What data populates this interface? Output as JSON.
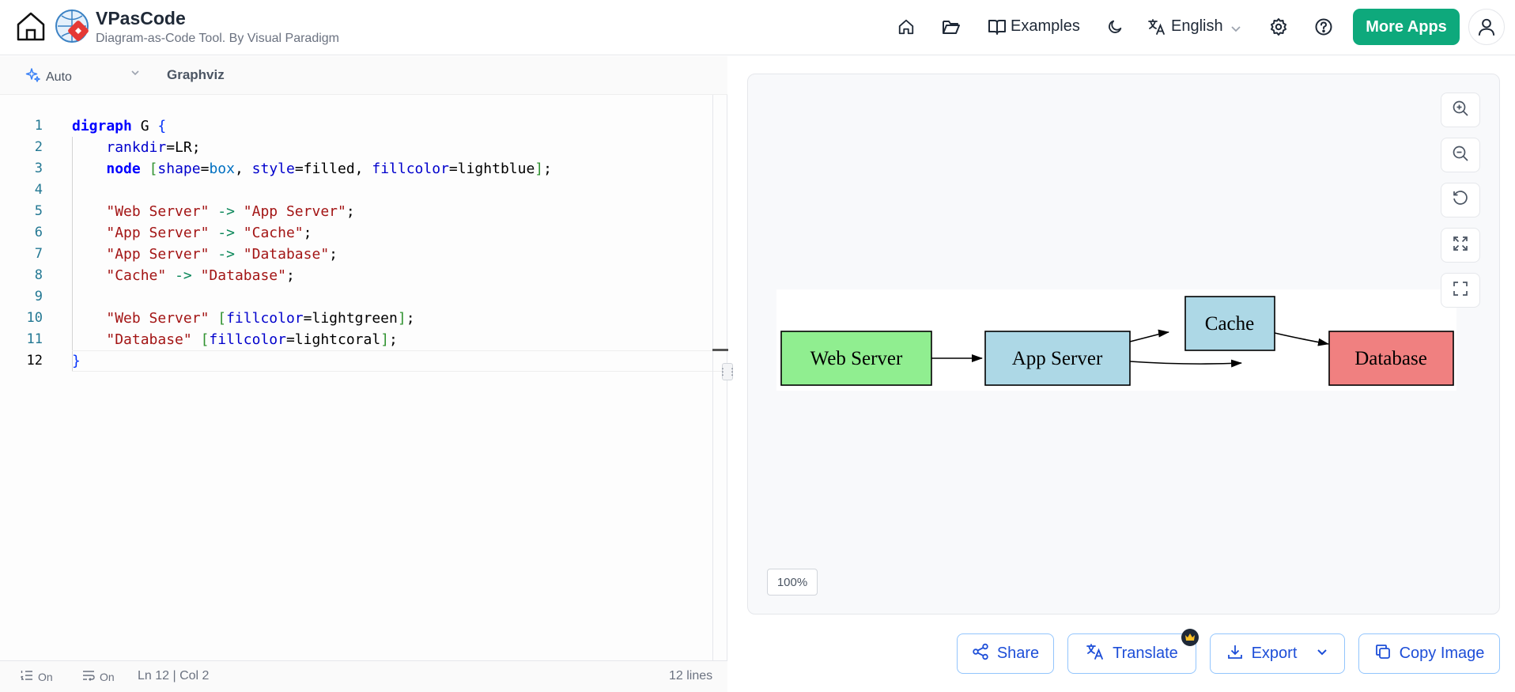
{
  "header": {
    "title": "VPasCode",
    "subtitle": "Diagram-as-Code Tool. By Visual Paradigm",
    "examples_label": "Examples",
    "language_label": "English",
    "more_apps_label": "More Apps"
  },
  "editor": {
    "mode_label": "Auto",
    "language_label": "Graphviz",
    "lines": [
      {
        "n": "1"
      },
      {
        "n": "2"
      },
      {
        "n": "3"
      },
      {
        "n": "4"
      },
      {
        "n": "5"
      },
      {
        "n": "6"
      },
      {
        "n": "7"
      },
      {
        "n": "8"
      },
      {
        "n": "9"
      },
      {
        "n": "10"
      },
      {
        "n": "11"
      },
      {
        "n": "12"
      }
    ],
    "code_text": "digraph G {\n    rankdir=LR;\n    node [shape=box, style=filled, fillcolor=lightblue];\n\n    \"Web Server\" -> \"App Server\";\n    \"App Server\" -> \"Cache\";\n    \"App Server\" -> \"Database\";\n    \"Cache\" -> \"Database\";\n\n    \"Web Server\" [fillcolor=lightgreen];\n    \"Database\" [fillcolor=lightcoral];\n}"
  },
  "status": {
    "line_numbers_label": "On",
    "word_wrap_label": "On",
    "cursor_position": "Ln 12 | Col 2",
    "line_count": "12 lines"
  },
  "diagram": {
    "nodes": [
      {
        "id": "web",
        "label": "Web Server",
        "color": "#90ee90"
      },
      {
        "id": "app",
        "label": "App Server",
        "color": "#add8e6"
      },
      {
        "id": "cache",
        "label": "Cache",
        "color": "#add8e6"
      },
      {
        "id": "db",
        "label": "Database",
        "color": "#f08080"
      }
    ],
    "edges": [
      {
        "from": "Web Server",
        "to": "App Server"
      },
      {
        "from": "App Server",
        "to": "Cache"
      },
      {
        "from": "App Server",
        "to": "Database"
      },
      {
        "from": "Cache",
        "to": "Database"
      }
    ]
  },
  "preview": {
    "zoom_level": "100%"
  },
  "actions": {
    "share_label": "Share",
    "translate_label": "Translate",
    "export_label": "Export",
    "copy_image_label": "Copy Image"
  },
  "colors": {
    "accent": "#0ea97c",
    "action_blue": "#1d4ed8"
  },
  "icons": [
    "home-icon",
    "folder-icon",
    "book-icon",
    "moon-icon",
    "translate-icon",
    "gear-icon",
    "help-icon",
    "user-icon",
    "sparkle-icon",
    "zoom-in-icon",
    "zoom-out-icon",
    "reset-icon",
    "fit-icon",
    "fullscreen-icon",
    "share-icon",
    "download-icon",
    "copy-icon",
    "crown-icon"
  ]
}
